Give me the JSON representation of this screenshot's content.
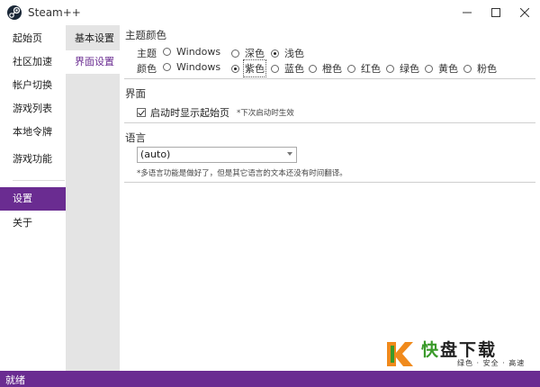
{
  "app": {
    "title": "Steam++"
  },
  "window_controls": {
    "minimize": "—",
    "maximize": "☐",
    "close": "✕"
  },
  "sidebar": {
    "items": [
      {
        "label": "起始页"
      },
      {
        "label": "社区加速"
      },
      {
        "label": "帐户切换"
      },
      {
        "label": "游戏列表"
      },
      {
        "label": "本地令牌"
      },
      {
        "label": "游戏功能"
      },
      {
        "label": "设置"
      },
      {
        "label": "关于"
      }
    ],
    "active_index": 6
  },
  "subnav": {
    "items": [
      {
        "label": "基本设置"
      },
      {
        "label": "界面设置"
      }
    ],
    "active_index": 1
  },
  "theme": {
    "title": "主题颜色",
    "theme_row": {
      "label": "主题",
      "options": [
        {
          "label": "Windows",
          "selected": false
        },
        {
          "label": "深色",
          "selected": false
        },
        {
          "label": "浅色",
          "selected": true
        }
      ]
    },
    "color_row": {
      "label": "颜色",
      "options": [
        {
          "label": "Windows",
          "selected": false
        },
        {
          "label": "紫色",
          "selected": true
        },
        {
          "label": "蓝色",
          "selected": false
        },
        {
          "label": "橙色",
          "selected": false
        },
        {
          "label": "红色",
          "selected": false
        },
        {
          "label": "绿色",
          "selected": false
        },
        {
          "label": "黄色",
          "selected": false
        },
        {
          "label": "粉色",
          "selected": false
        }
      ]
    }
  },
  "interface": {
    "title": "界面",
    "show_start_page": {
      "label": "启动时显示起始页",
      "checked": true
    },
    "hint": "*下次启动时生效"
  },
  "language": {
    "title": "语言",
    "selected": "(auto)",
    "hint": "*多语言功能是做好了，但是其它语言的文本还没有时间翻译。"
  },
  "status": {
    "text": "就绪"
  },
  "watermark": {
    "kuai": "快",
    "rest": "盘下载",
    "tagline": "绿色 · 安全 · 高速"
  },
  "colors": {
    "accent": "#6a2c91",
    "subnav_bg": "#e4e4e4"
  }
}
